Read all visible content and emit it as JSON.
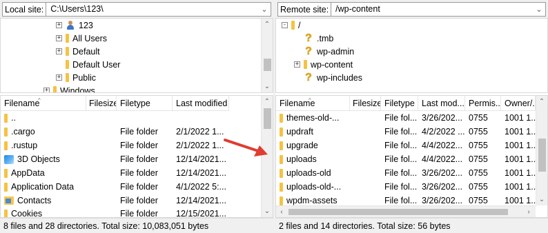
{
  "left": {
    "site_label": "Local site:",
    "path": "C:\\Users\\123\\",
    "tree": [
      {
        "label": "123",
        "icon": "user-folder-icon",
        "expander": "+"
      },
      {
        "label": "All Users",
        "icon": "folder-icon",
        "expander": "+"
      },
      {
        "label": "Default",
        "icon": "folder-icon",
        "expander": "+"
      },
      {
        "label": "Default User",
        "icon": "folder-icon",
        "expander": ""
      },
      {
        "label": "Public",
        "icon": "folder-icon",
        "expander": "+"
      },
      {
        "label": "Windows",
        "icon": "folder-icon",
        "expander": "+"
      }
    ],
    "columns": [
      "Filename",
      "Filesize",
      "Filetype",
      "Last modified"
    ],
    "rows": [
      {
        "name": "..",
        "size": "",
        "type": "",
        "modified": "",
        "icon": "folder-icon"
      },
      {
        "name": ".cargo",
        "size": "",
        "type": "File folder",
        "modified": "2/1/2022 1...",
        "icon": "folder-icon"
      },
      {
        "name": ".rustup",
        "size": "",
        "type": "File folder",
        "modified": "2/1/2022 1...",
        "icon": "folder-icon"
      },
      {
        "name": "3D Objects",
        "size": "",
        "type": "File folder",
        "modified": "12/14/2021...",
        "icon": "3d-objects-icon"
      },
      {
        "name": "AppData",
        "size": "",
        "type": "File folder",
        "modified": "12/14/2021...",
        "icon": "folder-icon"
      },
      {
        "name": "Application Data",
        "size": "",
        "type": "File folder",
        "modified": "4/1/2022 5:...",
        "icon": "folder-icon"
      },
      {
        "name": "Contacts",
        "size": "",
        "type": "File folder",
        "modified": "12/14/2021...",
        "icon": "contacts-icon"
      },
      {
        "name": "Cookies",
        "size": "",
        "type": "File folder",
        "modified": "12/15/2021...",
        "icon": "folder-icon"
      }
    ],
    "status": "8 files and 28 directories. Total size: 10,083,051 bytes"
  },
  "right": {
    "site_label": "Remote site:",
    "path": "/wp-content",
    "tree": [
      {
        "label": "/",
        "icon": "folder-icon",
        "expander": "-"
      },
      {
        "label": ".tmb",
        "icon": "question-icon",
        "expander": ""
      },
      {
        "label": "wp-admin",
        "icon": "question-icon",
        "expander": ""
      },
      {
        "label": "wp-content",
        "icon": "folder-icon",
        "expander": "+"
      },
      {
        "label": "wp-includes",
        "icon": "question-icon",
        "expander": ""
      }
    ],
    "columns": [
      "Filename",
      "Filesize",
      "Filetype",
      "Last mod...",
      "Permis...",
      "Owner/..."
    ],
    "rows": [
      {
        "name": "themes-old-...",
        "size": "",
        "type": "File fol...",
        "modified": "3/26/202...",
        "perms": "0755",
        "owner": "1001 1..."
      },
      {
        "name": "updraft",
        "size": "",
        "type": "File fol...",
        "modified": "4/2/2022 ...",
        "perms": "0755",
        "owner": "1001 1..."
      },
      {
        "name": "upgrade",
        "size": "",
        "type": "File fol...",
        "modified": "4/4/2022...",
        "perms": "0755",
        "owner": "1001 1..."
      },
      {
        "name": "uploads",
        "size": "",
        "type": "File fol...",
        "modified": "4/4/2022...",
        "perms": "0755",
        "owner": "1001 1..."
      },
      {
        "name": "uploads-old",
        "size": "",
        "type": "File fol...",
        "modified": "3/26/202...",
        "perms": "0755",
        "owner": "1001 1..."
      },
      {
        "name": "uploads-old-...",
        "size": "",
        "type": "File fol...",
        "modified": "3/26/202...",
        "perms": "0755",
        "owner": "1001 1..."
      },
      {
        "name": "wpdm-assets",
        "size": "",
        "type": "File fol...",
        "modified": "3/26/202...",
        "perms": "0755",
        "owner": "1001 1..."
      }
    ],
    "status": "2 files and 14 directories. Total size: 56 bytes"
  },
  "annotation": {
    "arrow_color": "#e03c31",
    "points_to": "uploads"
  },
  "icons": {
    "sort": "sort-ascending-icon",
    "combo": "chevron-down-icon"
  }
}
